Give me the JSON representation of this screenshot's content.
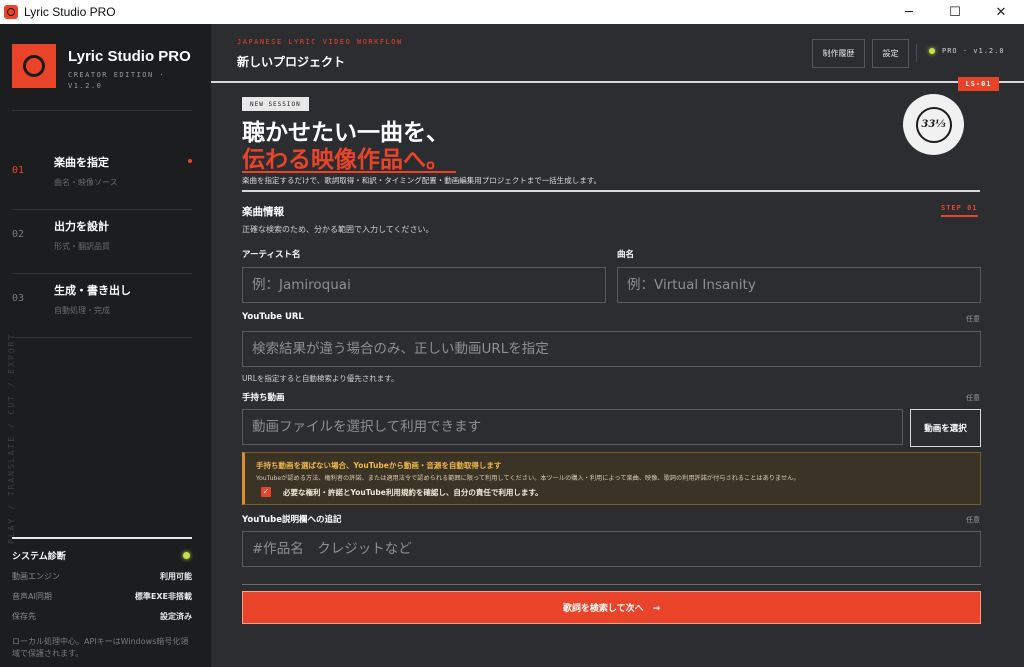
{
  "window": {
    "title": "Lyric Studio PRO",
    "controls": [
      "─",
      "☐",
      "✕"
    ]
  },
  "sidebar": {
    "brand": {
      "name": "Lyric Studio PRO",
      "edition": "CREATOR EDITION · V1.2.0"
    },
    "steps": [
      {
        "num": "01",
        "title": "楽曲を指定",
        "sub": "曲名・映像ソース",
        "active": true
      },
      {
        "num": "02",
        "title": "出力を設計",
        "sub": "形式・翻訳品質",
        "active": false
      },
      {
        "num": "03",
        "title": "生成・書き出し",
        "sub": "自動処理・完成",
        "active": false
      }
    ],
    "vertical_text": "PLAY / TRANSLATE / CUT / EXPORT",
    "diagnostics": {
      "title": "システム診断",
      "rows": [
        {
          "key": "動画エンジン",
          "value": "利用可能"
        },
        {
          "key": "音声AI同期",
          "value": "標準EXE非搭載"
        },
        {
          "key": "保存先",
          "value": "設定済み"
        }
      ],
      "note": "ローカル処理中心。APIキーはWindows暗号化領域で保護されます。"
    }
  },
  "header": {
    "eyebrow": "JAPANESE LYRIC VIDEO WORKFLOW",
    "title": "新しいプロジェクト",
    "history_button": "制作履歴",
    "settings_button": "設定",
    "status": "PRO · v1.2.0",
    "ls_tag": "LS-01"
  },
  "hero": {
    "session_tag": "NEW SESSION",
    "line1": "聴かせたい一曲を、",
    "line2": "伝わる映像作品へ。",
    "description": "楽曲を指定するだけで、歌詞取得・和訳・タイミング配置・動画編集用プロジェクトまで一括生成します。",
    "vinyl_label": "33⅓"
  },
  "section": {
    "title": "楽曲情報",
    "subtitle": "正確な検索のため、分かる範囲で入力してください。",
    "step_tag": "STEP 01"
  },
  "form": {
    "artist_label": "アーティスト名",
    "artist_placeholder": "例：Jamiroquai",
    "song_label": "曲名",
    "song_placeholder": "例：Virtual Insanity",
    "youtube_label": "YouTube URL",
    "youtube_optional": "任意",
    "youtube_placeholder": "検索結果が違う場合のみ、正しい動画URLを指定",
    "youtube_hint": "URLを指定すると自動検索より優先されます。",
    "video_label": "手持ち動画",
    "video_optional": "任意",
    "video_placeholder": "動画ファイルを選択して利用できます",
    "video_button": "動画を選択",
    "notice_title": "手持ち動画を選ばない場合、YouTubeから動画・音源を自動取得します",
    "notice_text": "YouTubeが認める方法、権利者の許諾、または適用法令で認められる範囲に限って利用してください。本ツールの購入・利用によって楽曲、映像、歌詞の利用許諾が付与されることはありません。",
    "notice_check": "必要な権利・許諾とYouTube利用規約を確認し、自分の責任で利用します。",
    "notice_checked": true,
    "desc_label": "YouTube説明欄への追記",
    "desc_optional": "任意",
    "desc_placeholder": "#作品名　クレジットなど",
    "submit": "歌詞を検索して次へ　→"
  },
  "colors": {
    "accent": "#e9442a",
    "status_green": "#c9e04a",
    "warning": "#f0b84a"
  }
}
